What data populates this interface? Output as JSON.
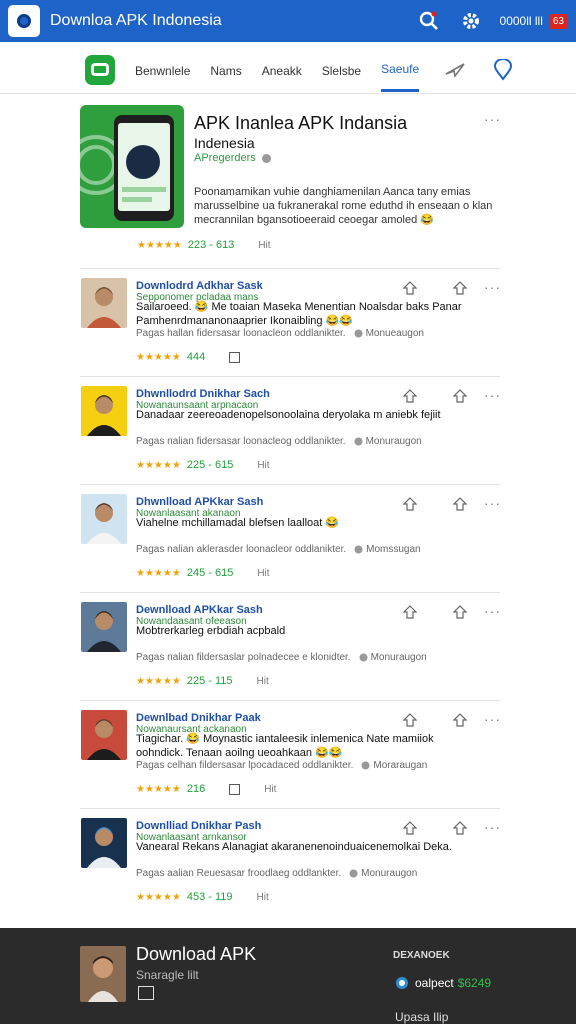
{
  "header": {
    "title": "Downloa APK Indonesia",
    "status": "0000ll lll",
    "badge": "63",
    "icons": [
      "search-icon",
      "gear-icon"
    ]
  },
  "tabs": {
    "items": [
      "Benwnlele",
      "Nams",
      "Aneakk",
      "Slelsbe",
      "Saeufe"
    ],
    "active": "Saeufe"
  },
  "hero": {
    "title": "APK Inanlea APK Indansia",
    "subtitle": "Indenesia",
    "developer": "APregerders",
    "description": "Poonamamikan vuhie danghiamenilan Aanca tany emias marusselbine ua fukranerakal rome eduthd ih enseaan o klan mecrannilan bgansotioeeraid ceoegar amoled 😂",
    "stars": "★★★★★",
    "rating": "223 - 613",
    "label": "Hit"
  },
  "items": [
    {
      "title": "Downlodrd Adkhar Sask",
      "subtitle": "Sepponomer pcladaa mans",
      "description": "Sailaroeed. 😂 Me toaian Maseka Menentian Noalsdar baks Panar Pamhenrdmananonaaprier Ikonaibling 😂😂",
      "location": "Pagas hallan fidersasar loonacleon oddlanikter.",
      "place": "Monueaugon",
      "rating": "444",
      "label": "",
      "has_box": true
    },
    {
      "title": "Dhwnllodrd Dnikhar Sach",
      "subtitle": "Nowanaunsaant arpnacaon",
      "description": "Danadaar zeereoadenopelsonoolaina deryolaka m aniebk fejiit",
      "location": "Pagas nalian fidersasar loonacleog oddlanikter.",
      "place": "Monuraugon",
      "rating": "225 - 615",
      "label": "Hit",
      "has_box": false
    },
    {
      "title": "Dhwnlload APKkar Sash",
      "subtitle": "Nowanlaasant akanaon",
      "description": "Viahelne mchillamadal blefsen laalloat 😂",
      "location": "Pagas nalian aklerasder loonacleor oddlanikter.",
      "place": "Momssugan",
      "rating": "245 - 615",
      "label": "Hit",
      "has_box": false
    },
    {
      "title": "Dewnlload APKkar Sash",
      "subtitle": "Nowandaasant ofeeason",
      "description": "Mobtrerkarleg erbdiah acpbald",
      "location": "Pagas nalian fildersaslar polnadecee e klonidter.",
      "place": "Monuraugon",
      "rating": "225 - 115",
      "label": "Hit",
      "has_box": false
    },
    {
      "title": "Dewnlbad Dnikhar Paak",
      "subtitle": "Nowanaursant ackanaon",
      "description": "Tiagichar. 😂 Moynastic iantaleesik inlemenica Nate mamiiok oohndick. Tenaan aoilng ueoahkaan 😂😂",
      "location": "Pagas celhan fildersasar lpocadaced oddlanikter.",
      "place": "Moraraugan",
      "rating": "216",
      "label": "Hit",
      "has_box": true
    },
    {
      "title": "Downlliad Dnikhar Pash",
      "subtitle": "Nowanlaasant arnkansor",
      "description": "Vanearal Rekans Alanagiat akaranenenoinduaicenemolkai Deka.",
      "location": "Pagas aalian Reuesasar froodlaeg oddlankter.",
      "place": "Monuraugon",
      "rating": "453 - 119",
      "label": "Hit",
      "has_box": false
    }
  ],
  "bottom_bar": {
    "title": "Download APK",
    "subtitle": "Snaragle lilt",
    "right_label": "DEXANOEK",
    "right_text": "oalpect",
    "right_value": "$6249",
    "right_footer": "Upasa Ilip"
  },
  "colors": {
    "primary": "#1e63c8",
    "green": "#2e9a3e",
    "star": "#f2a20c",
    "bottom_bg": "#2b2b2b"
  }
}
